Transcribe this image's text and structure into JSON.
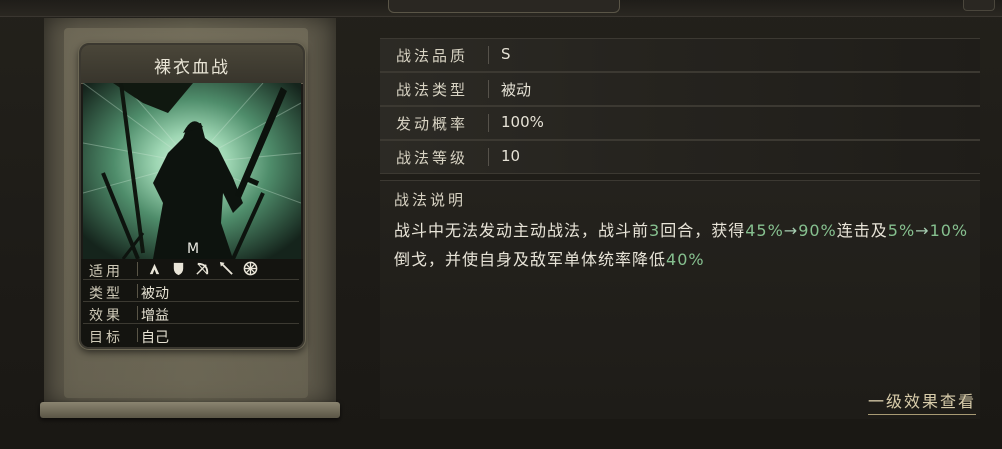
{
  "skill_card": {
    "title": "裸衣血战",
    "info": {
      "suitable_label": "适用",
      "type_label": "类型",
      "type_value": "被动",
      "effect_label": "效果",
      "effect_value": "增益",
      "target_label": "目标",
      "target_value": "自己"
    },
    "weapon_icons": [
      "spear-cavalry-icon",
      "shield-icon",
      "bow-icon",
      "spear-icon",
      "siege-wheel-icon"
    ]
  },
  "details": {
    "quality_label": "战法品质",
    "quality_value": "S",
    "type_label": "战法类型",
    "type_value": "被动",
    "chance_label": "发动概率",
    "chance_value": "100%",
    "level_label": "战法等级",
    "level_value": "10"
  },
  "description": {
    "title": "战法说明",
    "seg1": "战斗中无法发动主动战法，战斗前",
    "seg2": "3",
    "seg3": "回合，获得",
    "seg4": "45%",
    "seg5": "→",
    "seg6": "90%",
    "seg7": "连击及",
    "seg8": "5%",
    "seg9": "→",
    "seg10": "10%",
    "seg11": "倒戈，并使自身及敌军单体统率降低",
    "seg12": "40%"
  },
  "footer": {
    "first_level_link": "一级效果查看"
  },
  "colors": {
    "highlight_green": "#86c08f",
    "text_main": "#e8e4d8",
    "link": "#d8ccaa"
  }
}
